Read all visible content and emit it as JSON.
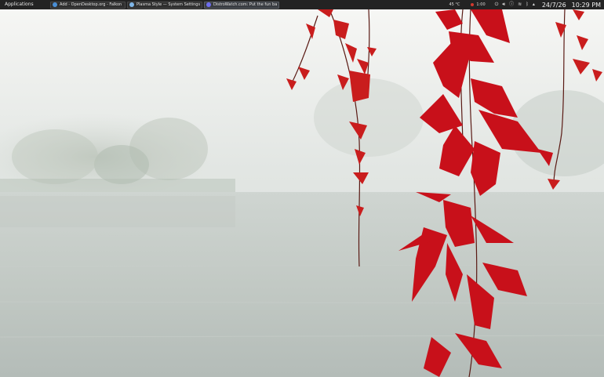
{
  "panel": {
    "app_menu_label": "Applications",
    "tasks": [
      {
        "label": "Add - OpenDesktop.org - Falkon",
        "icon": "falkon-icon",
        "color": "#4a8fd6"
      },
      {
        "label": "Plasma Style — System Settings",
        "icon": "settings-icon",
        "color": "#7fb6e8"
      },
      {
        "label": "DistroWatch.com: Put the fun back ...",
        "icon": "distrowatch-icon",
        "color": "#6d6df0"
      }
    ],
    "active_task": 2,
    "tray": {
      "temperature": "45 °C",
      "battery": "1:00",
      "icons": [
        "power-icon",
        "volume-icon",
        "notifications-icon",
        "network-icon",
        "bluetooth-icon",
        "expand-tray-icon"
      ]
    },
    "date": "24/7/26",
    "time": "10:29 PM"
  },
  "colors": {
    "panel_bg": "#232323",
    "leaf_red": "#c8101a",
    "mist": "#dfe3e1"
  }
}
